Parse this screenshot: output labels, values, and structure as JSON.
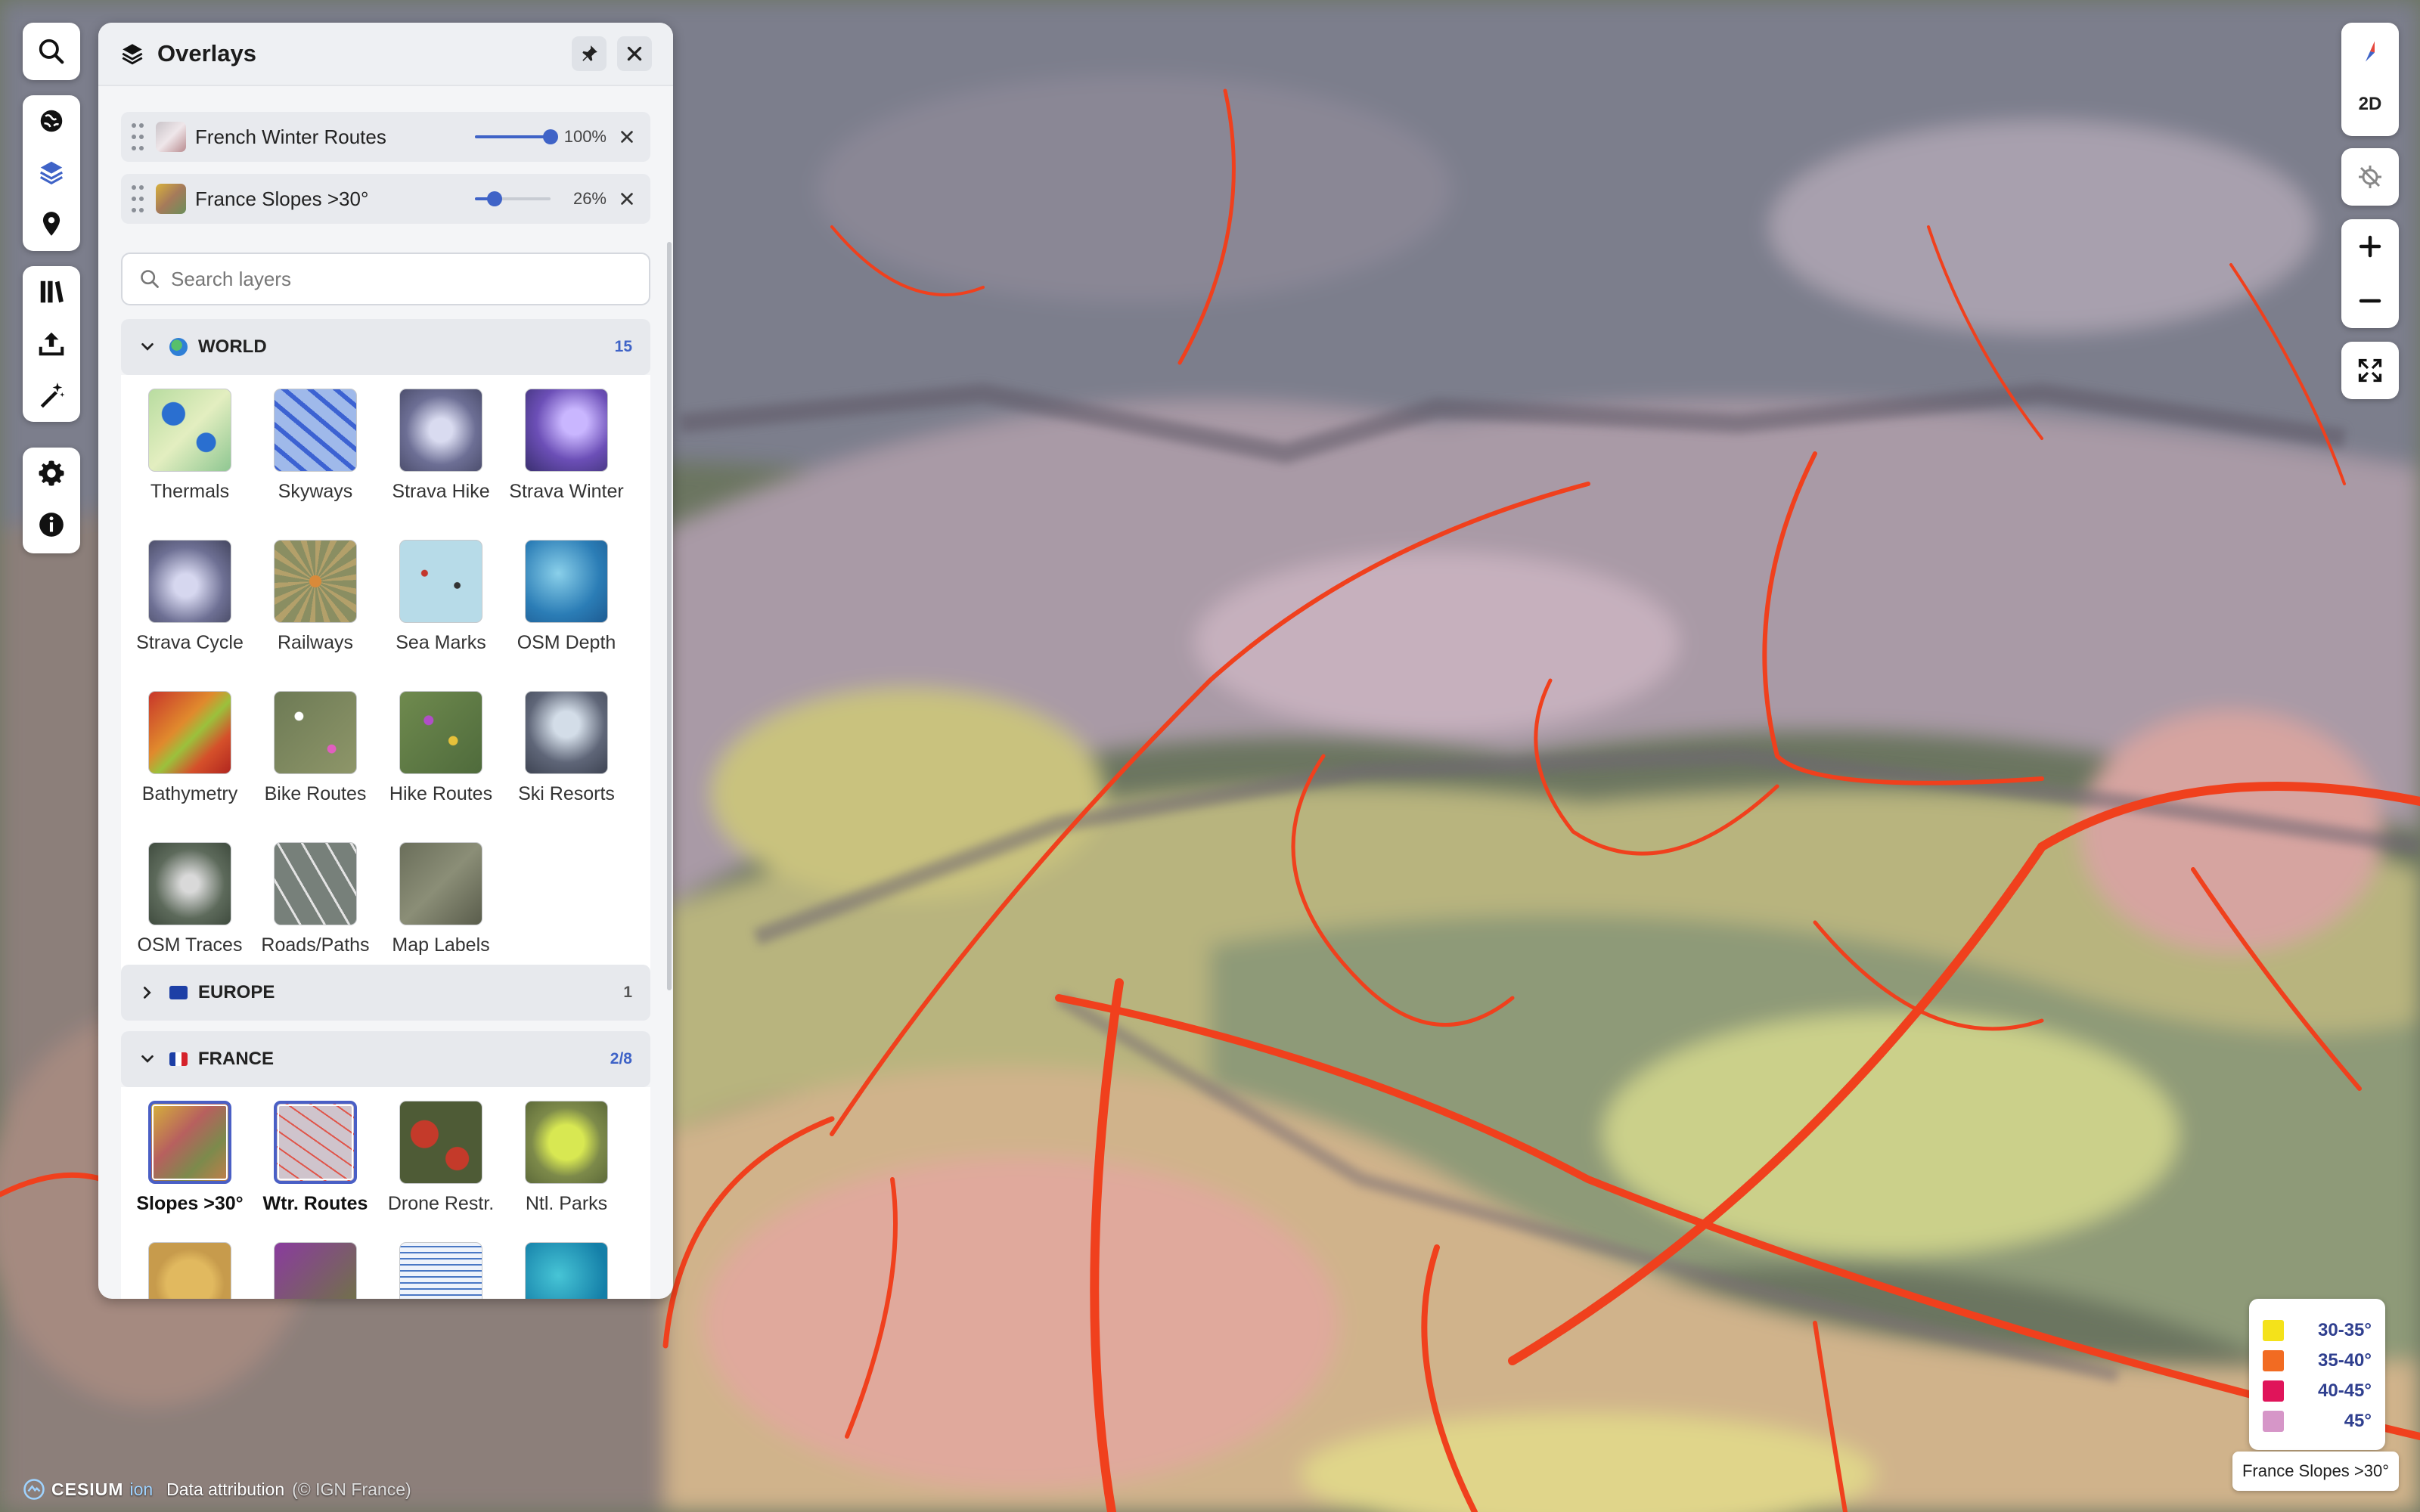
{
  "panel": {
    "title": "Overlays",
    "active_layers": [
      {
        "label": "French Winter Routes",
        "opacity_text": "100%",
        "opacity": 1.0
      },
      {
        "label": "France Slopes >30°",
        "opacity_text": "26%",
        "opacity": 0.26
      }
    ],
    "search_placeholder": "Search layers",
    "sections": [
      {
        "name": "WORLD",
        "count": "15",
        "tiles": [
          "Thermals",
          "Skyways",
          "Strava Hike",
          "Strava Winter",
          "Strava Cycle",
          "Railways",
          "Sea Marks",
          "OSM Depth",
          "Bathymetry",
          "Bike Routes",
          "Hike Routes",
          "Ski Resorts",
          "OSM Traces",
          "Roads/Paths",
          "Map Labels"
        ]
      },
      {
        "name": "EUROPE",
        "count": "1"
      },
      {
        "name": "FRANCE",
        "count": "2/8",
        "tiles": [
          "Slopes >30°",
          "Wtr. Routes",
          "Drone Restr.",
          "Ntl. Parks"
        ]
      }
    ]
  },
  "controls": {
    "view_mode": "2D"
  },
  "legend": {
    "items": [
      {
        "label": "30-35°",
        "color": "#f4e21a"
      },
      {
        "label": "35-40°",
        "color": "#f26b22"
      },
      {
        "label": "40-45°",
        "color": "#e0145a"
      },
      {
        "label": "45°",
        "color": "#d696c8"
      }
    ],
    "caption": "France Slopes >30°"
  },
  "attribution": {
    "logo_text": "CESIUM",
    "logo_suffix": "ion",
    "text": "Data attribution",
    "source": "(© IGN France)"
  },
  "icons": {
    "left_rail": [
      "search-icon",
      "globe-icon",
      "layers-icon",
      "location-pin-icon",
      "library-icon",
      "upload-icon",
      "magic-wand-icon",
      "gear-icon",
      "info-icon"
    ],
    "right_rail": [
      "compass-icon",
      "crosshair-off-icon",
      "zoom-in-icon",
      "zoom-out-icon",
      "fullscreen-icon"
    ]
  },
  "accent_color": "#3f63c7"
}
